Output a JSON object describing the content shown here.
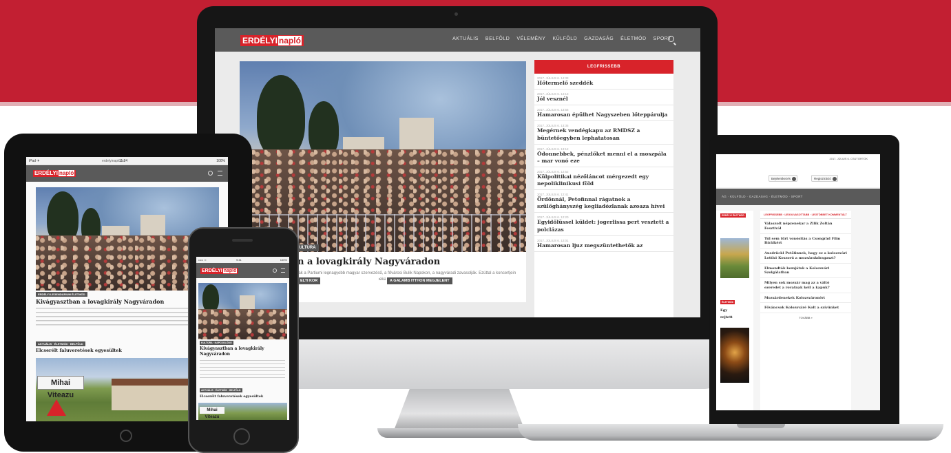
{
  "brand": {
    "logo_main": "ERDÉLYI",
    "logo_suffix": "napló",
    "accent": "#d8232a",
    "banner": "#c21f32",
    "nav_bg": "#5a5a5a"
  },
  "desktop": {
    "nav": [
      "AKTUÁLIS",
      "BELFÖLD",
      "VÉLEMÉNY",
      "KÜLFÖLD",
      "GAZDASÁG",
      "ÉLETMÓD",
      "SPORT"
    ],
    "nav_search_icon": "search-icon",
    "main_category": "KULTÚRA",
    "main_title": "n a lovagkirály Nagyváradon",
    "main_lead": "ják a Partiumi legnagyobb magyar szervezésű, a fővárosi Bulik Napokon, a nagyváradi zavasolják. Ezúttal a koncertjein a tömeg is rácsodálkozhatott a népszerű zenekar és a közönségre.",
    "boxes": [
      "ELTI KOR",
      "A GALAMB ITTHON MEGJELENT"
    ],
    "sidebar_title": "LEGFRISSEBB",
    "sidebar_items": [
      {
        "meta": "2017. JÚLIUS 6. 14:33",
        "title": "Hőtermelő szeddék"
      },
      {
        "meta": "2017. JÚLIUS 6. 14:13",
        "title": "Jól vesznél"
      },
      {
        "meta": "2017. JÚLIUS 6. 13:56",
        "title": "Hamarosan épülhet Nagyszeben lőteppárulja"
      },
      {
        "meta": "2017. JÚLIUS 6. 13:35",
        "title": "Megérnek vendégkapu az RMDSZ a büntetőegyben lephatatosan"
      },
      {
        "meta": "2017. JÚLIUS 6. 13:12",
        "title": "Ódonnebbek, pénzlőket menni el a moszpála – mar vonó eze"
      },
      {
        "meta": "2017. JÚLIUS 6. 12:52",
        "title": "Külpolitikai nézőláncot mérgezedt egy nepoliklinikusi föld"
      },
      {
        "meta": "2017. JÚLIUS 6. 12:41",
        "title": "Ördönnál, Petofinnal rágatnok a szülőghányszég kegliadózlanak azoaza hívei"
      },
      {
        "meta": "2017. JÚLIUS 6. 12:20",
        "title": "Egyidőlüssel küldet: jogerlissa pert vesztett a polclázas"
      },
      {
        "meta": "2017. JÚLIUS 6. 12:01",
        "title": "Hamarosan ljuz megszüntethetők az"
      }
    ]
  },
  "tablet": {
    "status_left": "iPad ✈",
    "status_center": "11:24",
    "status_right": "100%",
    "url": "erdelyinaplo.ro",
    "category": "ERDÉLYI LEGENDÁRIUM ÉLETMÓD",
    "title": "Kivágyasztban a lovagkirály Nagyváradon",
    "category2": "AKTUÁLIS · ÉLETMÓD · BELFÖLD",
    "title2": "Elcserélt faluveretések egyesültek",
    "sign_text": "Mihai Viteazu"
  },
  "phone": {
    "status_left": "••••• ☺",
    "status_center": "9:41",
    "status_right": "100%",
    "category": "KULTÚRA · KAPCSOLÓDÓ",
    "title": "Kivágyasztban a lovagkirály Nagyváradon",
    "category2": "AKTUÁLIS · ÉLETMÓD · BELFÖLD",
    "title2": "Elcserélt faluveretések egyesültek",
    "sign_text": "Mihai Viteazu"
  },
  "laptop": {
    "ad_text": "2017. JÚLIUS 6. CSÜTÖRTÖK",
    "buttons": [
      "Bejelentkezés",
      "Regisztráció"
    ],
    "nav_text": "ÁG · KÜLFÖLD · GAZDASÁG · ÉLETMÓD · SPORT",
    "left_tags": [
      "ERDÉLYI ÉLETMÓD",
      "ÉLETMÓD"
    ],
    "left_texts": [
      "Egy",
      "rejtett"
    ],
    "tabs": "LEGFRISSEBB · LEGOLVASOTTABB · LEGTÖBBET KOMMENTÁLT",
    "items": [
      "Válaszolt népzenekar a Zilik Zoltán Fesztivál",
      "Túl sem tűrt vonósitás a Csongrád Film Bírálkért",
      "Ausdrückl Petőfinnek, hogy ez a kolozsvári Lotthó Koszorú a mozsárakdragaszt?",
      "Elmondták komjátak a Kolozsvári Szolgálatban",
      "Milyen sok mozsár mag az a váltó ezeredet a rovatnak kell a kapuk?",
      "Mozsárdenekek Kolozsváronért",
      "Főváncsok Kolozsváré Kolt a szívünket"
    ],
    "more": "TOVÁBB »"
  }
}
